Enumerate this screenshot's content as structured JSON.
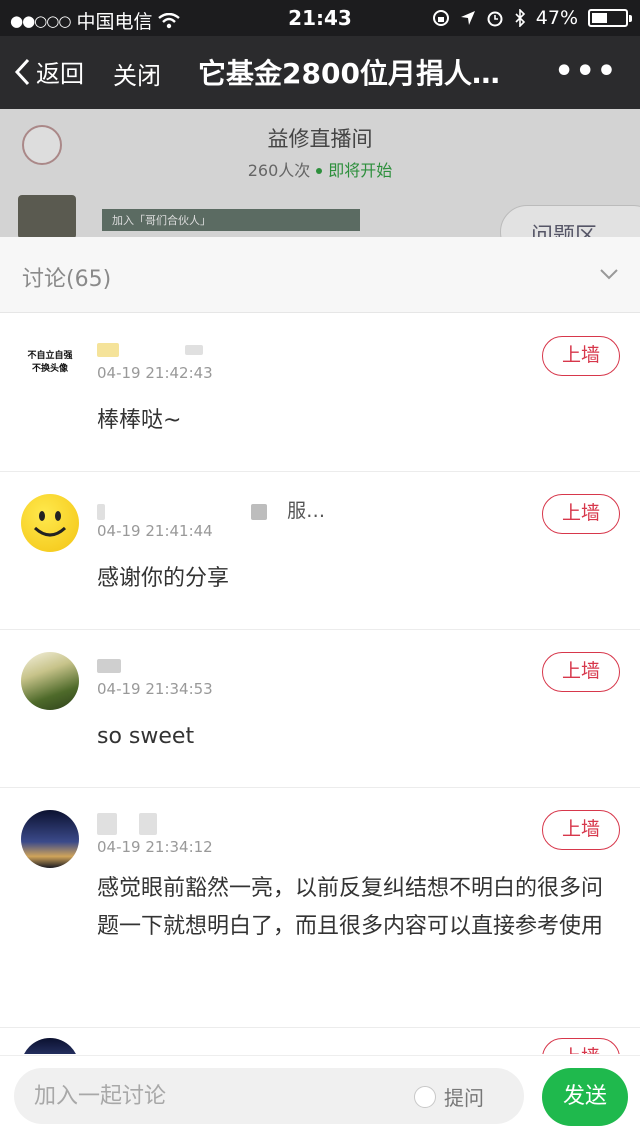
{
  "status_bar": {
    "carrier": "中国电信",
    "time": "21:43",
    "battery_percent": "47%",
    "battery_level": 0.47
  },
  "nav": {
    "back_label": "返回",
    "close_label": "关闭",
    "title": "它基金2800位月捐人…",
    "more": "•••"
  },
  "room": {
    "title": "益修直播间",
    "visits": "260人次",
    "status": "即将开始",
    "banner_text": "加入「哥们合伙人」",
    "qa_label": "问题区"
  },
  "discussion": {
    "header": "讨论(65)",
    "wall_label": "上墙",
    "comments": [
      {
        "name": "",
        "avatar_text": "不自立自强\n不换头像",
        "time": "04-19 21:42:43",
        "text": "棒棒哒~"
      },
      {
        "name": "服…",
        "time": "04-19 21:41:44",
        "text": "感谢你的分享"
      },
      {
        "name": "",
        "time": "04-19 21:34:53",
        "text": "so sweet"
      },
      {
        "name": "",
        "time": "04-19 21:34:12",
        "text": "感觉眼前豁然一亮，以前反复纠结想不明白的很多问题一下就想明白了，而且很多内容可以直接参考使用"
      }
    ]
  },
  "input": {
    "placeholder": "加入一起讨论",
    "ask_label": "提问",
    "send_label": "发送"
  },
  "colors": {
    "accent_green": "#1fb94d",
    "wall_red": "#d7374b",
    "nav_bg": "#2b2b2d"
  }
}
